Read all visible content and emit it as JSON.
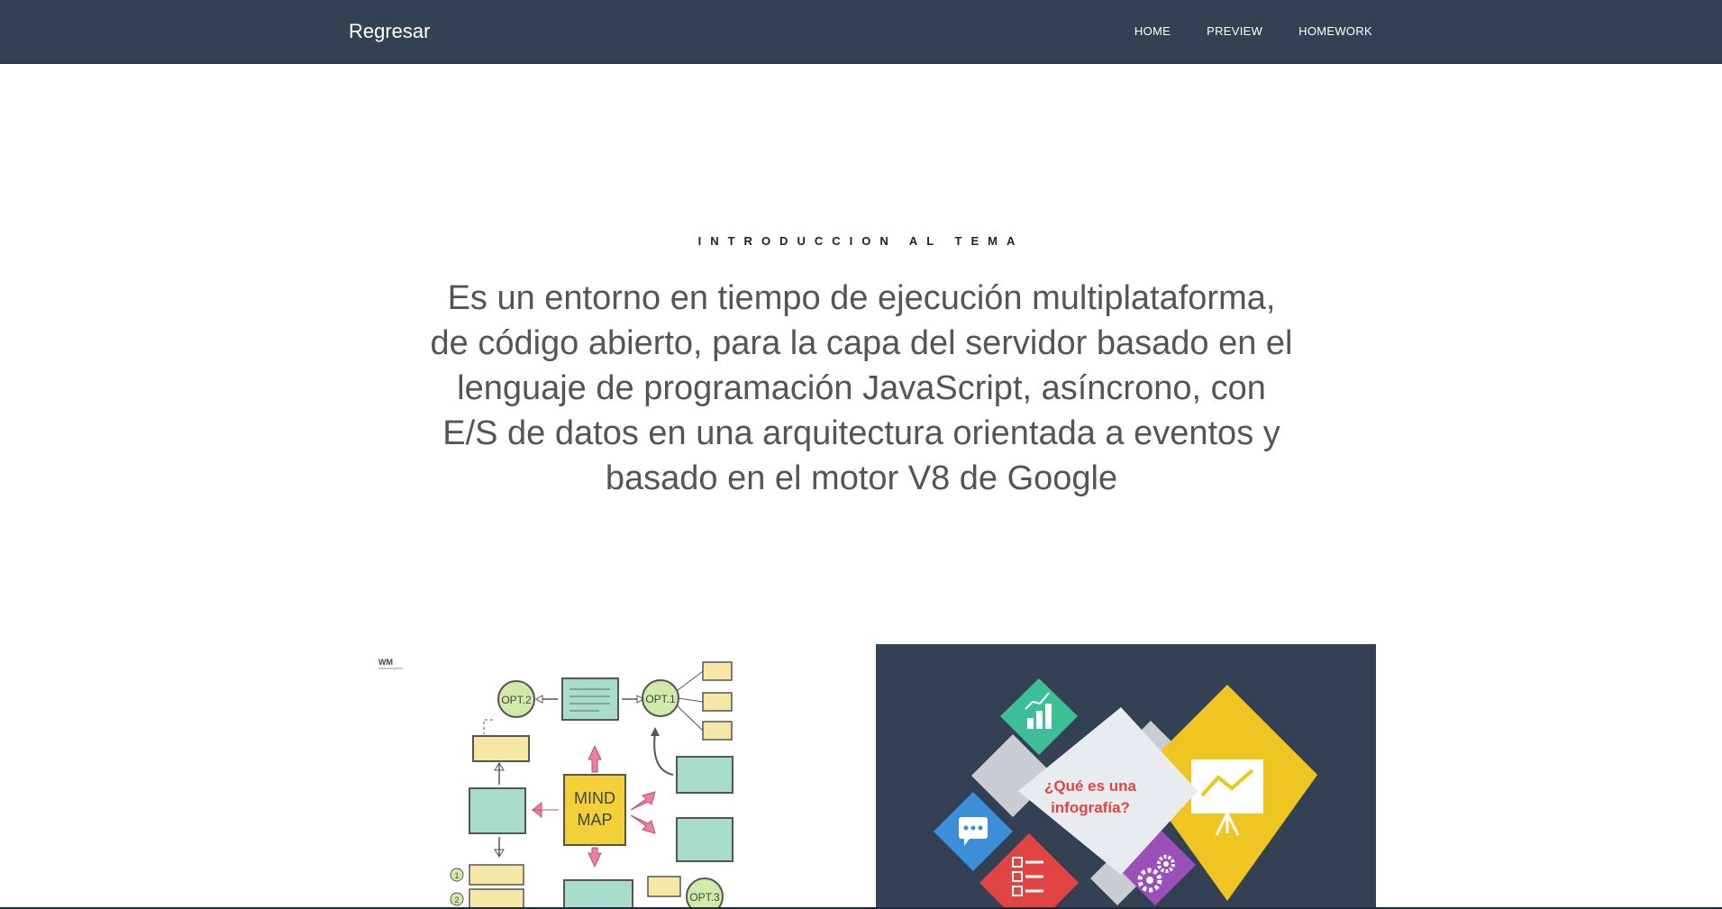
{
  "navbar": {
    "brand": "Regresar",
    "links": [
      "HOME",
      "PREVIEW",
      "HOMEWORK"
    ]
  },
  "intro": {
    "label": "INTRODUCCION AL TEMA",
    "text": "Es un entorno en tiempo de ejecución multiplataforma, de código abierto, para la capa del servidor basado en el lenguaje de programación JavaScript, asíncrono, con E/S de datos en una arquitectura orientada a eventos y basado en el motor V8 de Google"
  },
  "mindmap": {
    "logo": "WM",
    "center": [
      "MIND",
      "MAP"
    ],
    "opt1": "OPT.1",
    "opt2": "OPT.2",
    "opt3": "OPT.3",
    "num1": "1",
    "num2": "2"
  },
  "infographic": {
    "question": [
      "¿Qué es una",
      "infografía?"
    ],
    "colors": {
      "background": "#344155",
      "green": "#3dbf95",
      "yellow": "#eec521",
      "blue": "#3a8fd8",
      "red": "#e24444",
      "purple": "#9b4fb8",
      "center": "#e9ecee",
      "accent_text": "#e24444"
    },
    "icons": [
      "bar-chart-icon",
      "presentation-icon",
      "chat-icon",
      "checklist-icon",
      "gears-icon"
    ]
  }
}
